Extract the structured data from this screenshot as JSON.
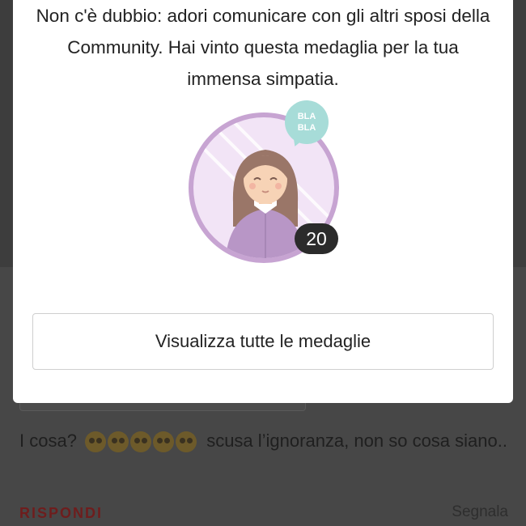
{
  "modal": {
    "message": "Non c'è dubbio: adori comunicare con gli altri sposi della Community. Hai vinto questa medaglia per la tua immensa simpatia.",
    "badge": {
      "bubble_line1": "BLA",
      "bubble_line2": "BLA",
      "count": "20"
    },
    "button_label": "Visualizza tutte le medaglie"
  },
  "background": {
    "comment_prefix": "I cosa?",
    "comment_suffix": "scusa l’ignoranza, non so cosa siano..",
    "reply_label": "RISPONDI",
    "report_label": "Segnala"
  },
  "colors": {
    "badge_ring": "#c7a4d2",
    "badge_fill": "#f2e4f6",
    "bubble": "#a7dcd8",
    "count_pill": "#2b2b2b"
  }
}
